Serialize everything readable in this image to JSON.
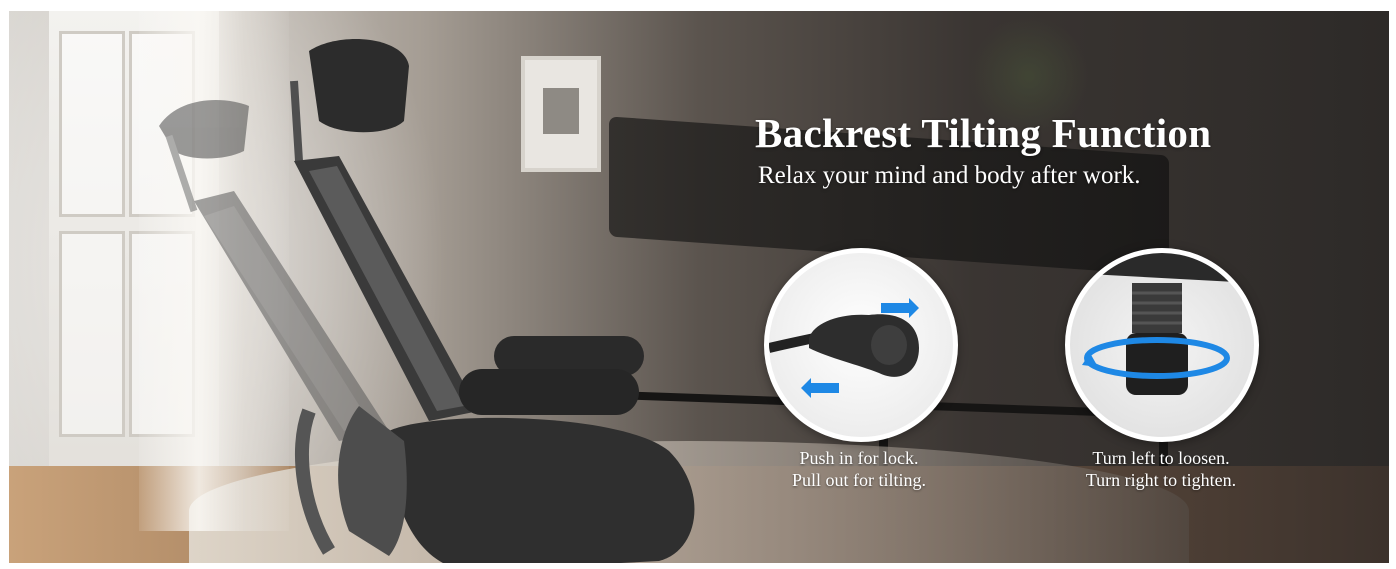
{
  "banner": {
    "title": "Backrest Tilting Function",
    "subtitle": "Relax your mind and body after work.",
    "features": [
      {
        "icon": "lever-handle-icon",
        "caption_line1": "Push in for lock.",
        "caption_line2": "Pull out for tilting."
      },
      {
        "icon": "tension-knob-icon",
        "caption_line1": "Turn left to loosen.",
        "caption_line2": "Turn right to tighten."
      }
    ],
    "colors": {
      "text": "#ffffff",
      "arrow": "#1e88e5"
    }
  }
}
